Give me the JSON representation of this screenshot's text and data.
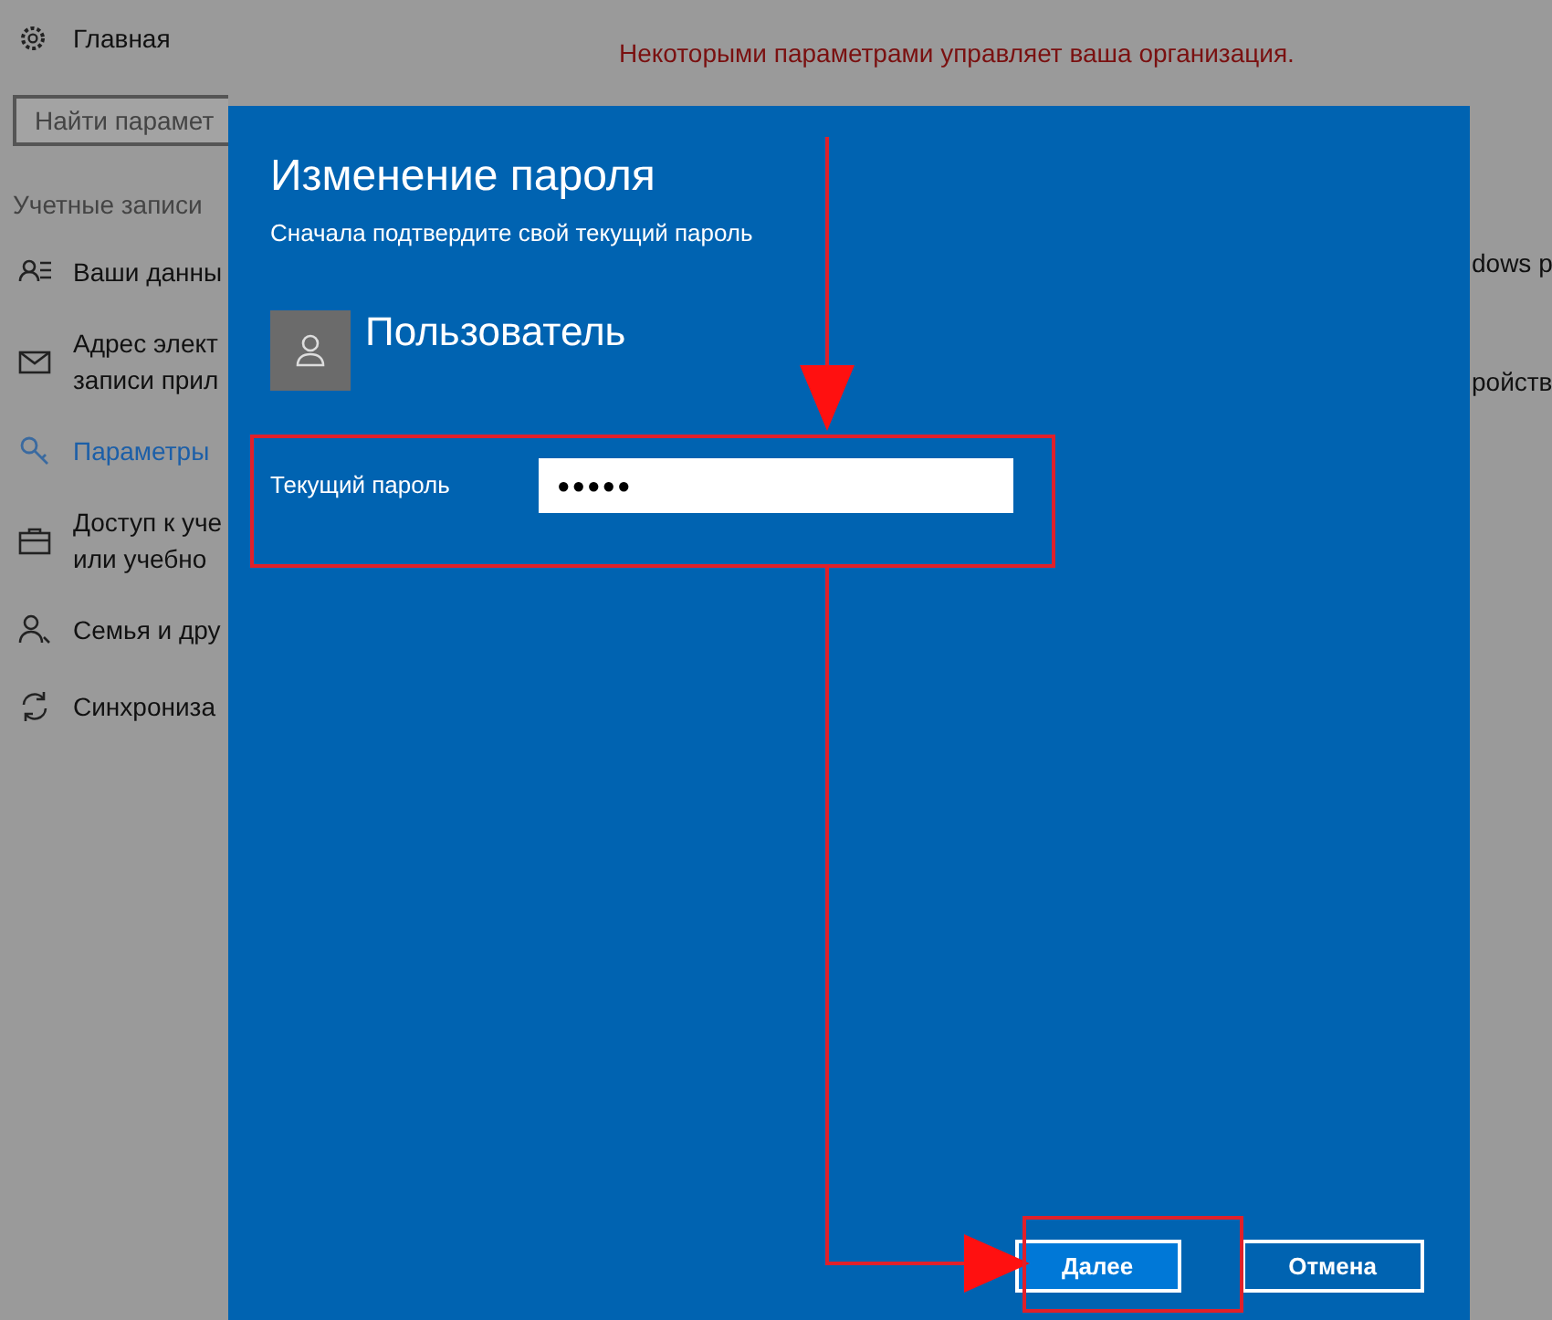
{
  "settings": {
    "home": "Главная",
    "search": {
      "placeholder": "Найти парамет"
    },
    "section": "Учетные записи",
    "items": [
      {
        "lines": [
          "Ваши данны"
        ],
        "selected": false
      },
      {
        "lines": [
          "Адрес элект",
          "записи прил"
        ],
        "selected": false
      },
      {
        "lines": [
          "Параметры"
        ],
        "selected": true
      },
      {
        "lines": [
          "Доступ к уче",
          "или учебно"
        ],
        "selected": false
      },
      {
        "lines": [
          "Семья и дру"
        ],
        "selected": false
      },
      {
        "lines": [
          "Синхрониза"
        ],
        "selected": false
      }
    ],
    "notice": "Некоторыми параметрами управляет ваша организация.",
    "right_texts": [
      "dows p",
      "ройств"
    ]
  },
  "dialog": {
    "title": "Изменение пароля",
    "subtitle": "Сначала подтвердите свой текущий пароль",
    "user": "Пользователь",
    "password": {
      "label": "Текущий пароль",
      "value": "●●●●●"
    },
    "buttons": [
      {
        "label": "Далее",
        "kind": "primary"
      },
      {
        "label": "Отмена",
        "kind": "secondary"
      }
    ]
  }
}
